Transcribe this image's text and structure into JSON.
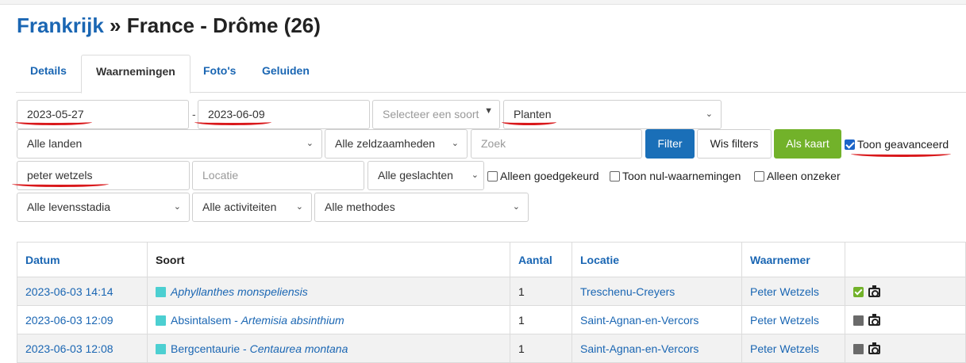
{
  "title": {
    "link": "Frankrijk",
    "rest": " » France - Drôme (26)"
  },
  "tabs": [
    "Details",
    "Waarnemingen",
    "Foto's",
    "Geluiden"
  ],
  "filters": {
    "date_from": "2023-05-27",
    "date_sep": "-",
    "date_to": "2023-06-09",
    "species_placeholder": "Selecteer een soort",
    "group": "Planten",
    "country": "Alle landen",
    "rarity": "Alle zeldzaamheden",
    "search_placeholder": "Zoek",
    "filter_button": "Filter",
    "clear_button": "Wis filters",
    "map_button": "Als kaart",
    "advanced_label": "Toon geavanceerd",
    "observer": "peter wetzels",
    "location_placeholder": "Locatie",
    "sex": "Alle geslachten",
    "approved_only": "Alleen goedgekeurd",
    "show_zero": "Toon nul-waarnemingen",
    "uncertain_only": "Alleen onzeker",
    "life_stage": "Alle levensstadia",
    "activity": "Alle activiteiten",
    "method": "Alle methodes"
  },
  "table": {
    "headers": [
      "Datum",
      "Soort",
      "Aantal",
      "Locatie",
      "Waarnemer"
    ],
    "rows": [
      {
        "date": "2023-06-03 14:14",
        "common": "",
        "sci": "Aphyllanthes monspeliensis",
        "count": "1",
        "location": "Treschenu-Creyers",
        "observer": "Peter Wetzels",
        "status": "approved"
      },
      {
        "date": "2023-06-03 12:09",
        "common": "Absintalsem - ",
        "sci": "Artemisia absinthium",
        "count": "1",
        "location": "Saint-Agnan-en-Vercors",
        "observer": "Peter Wetzels",
        "status": "pending"
      },
      {
        "date": "2023-06-03 12:08",
        "common": "Bergcentaurie - ",
        "sci": "Centaurea montana",
        "count": "1",
        "location": "Saint-Agnan-en-Vercors",
        "observer": "Peter Wetzels",
        "status": "pending"
      }
    ]
  },
  "colors": {
    "link": "#1a66b3",
    "primary": "#1a6fb8",
    "success": "#72b22a",
    "species_marker": "#4ccfd1",
    "annotation": "#d9191c"
  },
  "icons": [
    "check-icon",
    "camera-icon",
    "status-square-icon",
    "caret-down-icon"
  ]
}
